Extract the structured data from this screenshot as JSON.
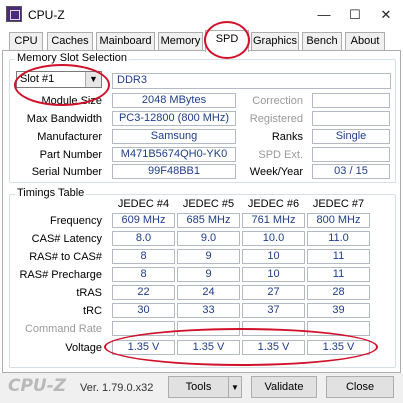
{
  "window": {
    "title": "CPU-Z",
    "min": "—",
    "max": "☐",
    "close": "✕"
  },
  "tabs": [
    "CPU",
    "Caches",
    "Mainboard",
    "Memory",
    "SPD",
    "Graphics",
    "Bench",
    "About"
  ],
  "slot": {
    "group_title": "Memory Slot Selection",
    "selected": "Slot #1",
    "type": "DDR3",
    "labels": {
      "module_size": "Module Size",
      "max_bandwidth": "Max Bandwidth",
      "manufacturer": "Manufacturer",
      "part_number": "Part Number",
      "serial_number": "Serial Number",
      "correction": "Correction",
      "registered": "Registered",
      "ranks": "Ranks",
      "spd_ext": "SPD Ext.",
      "week_year": "Week/Year"
    },
    "values": {
      "module_size": "2048 MBytes",
      "max_bandwidth": "PC3-12800 (800 MHz)",
      "manufacturer": "Samsung",
      "part_number": "M471B5674QH0-YK0",
      "serial_number": "99F48BB1",
      "correction": "",
      "registered": "",
      "ranks": "Single",
      "spd_ext": "",
      "week_year": "03 / 15"
    }
  },
  "timings": {
    "group_title": "Timings Table",
    "headers": [
      "JEDEC #4",
      "JEDEC #5",
      "JEDEC #6",
      "JEDEC #7"
    ],
    "rows": [
      {
        "label": "Frequency",
        "values": [
          "609 MHz",
          "685 MHz",
          "761 MHz",
          "800 MHz"
        ]
      },
      {
        "label": "CAS# Latency",
        "values": [
          "8.0",
          "9.0",
          "10.0",
          "11.0"
        ]
      },
      {
        "label": "RAS# to CAS#",
        "values": [
          "8",
          "9",
          "10",
          "11"
        ]
      },
      {
        "label": "RAS# Precharge",
        "values": [
          "8",
          "9",
          "10",
          "11"
        ]
      },
      {
        "label": "tRAS",
        "values": [
          "22",
          "24",
          "27",
          "28"
        ]
      },
      {
        "label": "tRC",
        "values": [
          "30",
          "33",
          "37",
          "39"
        ]
      },
      {
        "label": "Command Rate",
        "values": [
          "",
          "",
          "",
          ""
        ],
        "disabled": true
      },
      {
        "label": "Voltage",
        "values": [
          "1.35 V",
          "1.35 V",
          "1.35 V",
          "1.35 V"
        ]
      }
    ]
  },
  "footer": {
    "brand": "CPU-Z",
    "version": "Ver. 1.79.0.x32",
    "tools": "Tools",
    "validate": "Validate",
    "close": "Close"
  },
  "colors": {
    "highlight": "#d0112b",
    "value_text": "#1f3d8a"
  }
}
